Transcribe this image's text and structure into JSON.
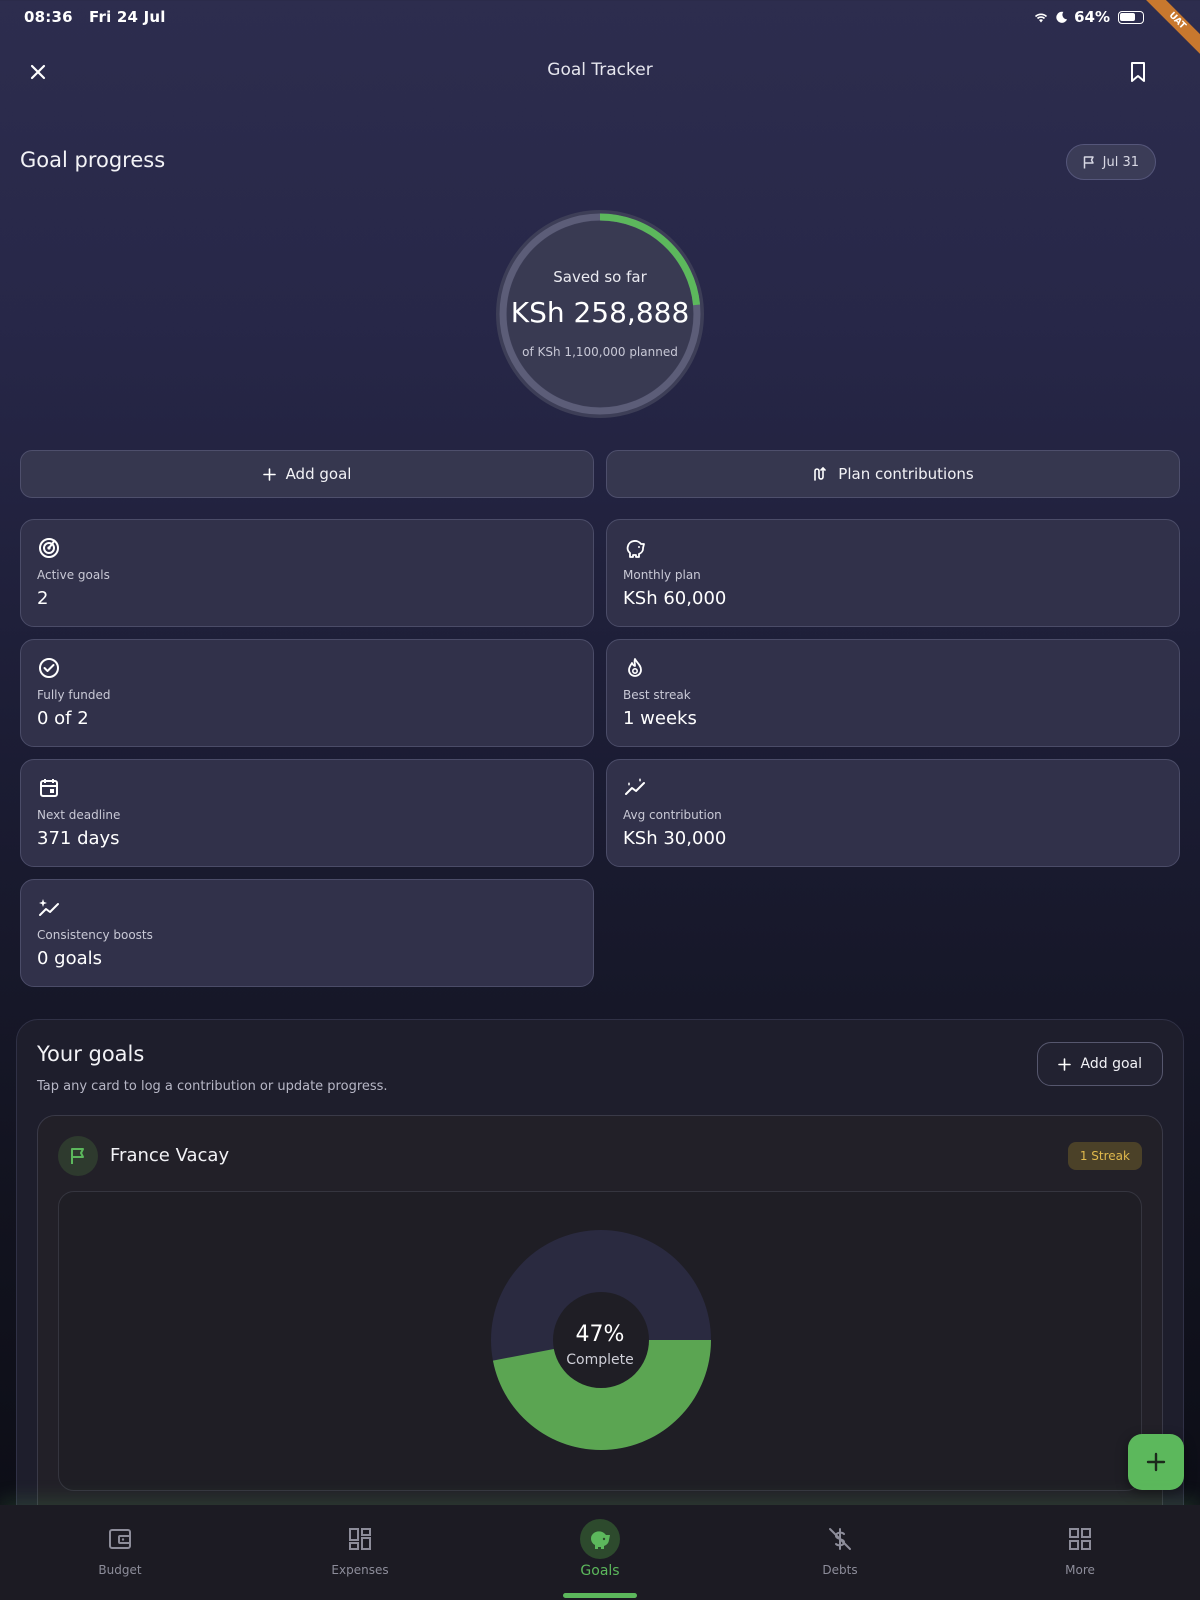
{
  "status_bar": {
    "time": "08:36",
    "date": "Fri 24 Jul",
    "battery": "64%",
    "badge": "UAT"
  },
  "appbar": {
    "title": "Goal Tracker",
    "close_icon": "close-icon",
    "bookmark_icon": "bookmark-icon"
  },
  "progress": {
    "title": "Goal progress",
    "date_chip": "Jul 31",
    "saved_label": "Saved so far",
    "saved_amount": "KSh 258,888",
    "planned_text": "of KSh 1,100,000 planned",
    "fraction": 0.235
  },
  "actions": {
    "add_goal": "Add goal",
    "plan_contributions": "Plan contributions"
  },
  "stats": [
    {
      "icon": "target-icon",
      "label": "Active goals",
      "value": "2"
    },
    {
      "icon": "piggy-bank-icon",
      "label": "Monthly plan",
      "value": "KSh 60,000"
    },
    {
      "icon": "check-circle-icon",
      "label": "Fully funded",
      "value": "0 of 2"
    },
    {
      "icon": "flame-icon",
      "label": "Best streak",
      "value": "1 weeks"
    },
    {
      "icon": "calendar-icon",
      "label": "Next deadline",
      "value": "371 days"
    },
    {
      "icon": "trend-icon",
      "label": "Avg contribution",
      "value": "KSh 30,000"
    },
    {
      "icon": "sparkle-trend-icon",
      "label": "Consistency boosts",
      "value": "0 goals"
    }
  ],
  "goals_panel": {
    "title": "Your goals",
    "subtitle": "Tap any card to log a contribution or update progress.",
    "add_goal": "Add goal",
    "goals": [
      {
        "name": "France Vacay",
        "streak": "1 Streak",
        "percent": "47%",
        "complete_label": "Complete",
        "fraction": 0.47
      }
    ]
  },
  "colors": {
    "accent": "#5cb85c",
    "streak": "#e0b94c"
  },
  "nav": [
    {
      "label": "Budget",
      "icon": "wallet-icon"
    },
    {
      "label": "Expenses",
      "icon": "dashboard-icon"
    },
    {
      "label": "Goals",
      "icon": "piggy-bank-icon",
      "active": true
    },
    {
      "label": "Debts",
      "icon": "no-money-icon"
    },
    {
      "label": "More",
      "icon": "grid-icon"
    }
  ]
}
